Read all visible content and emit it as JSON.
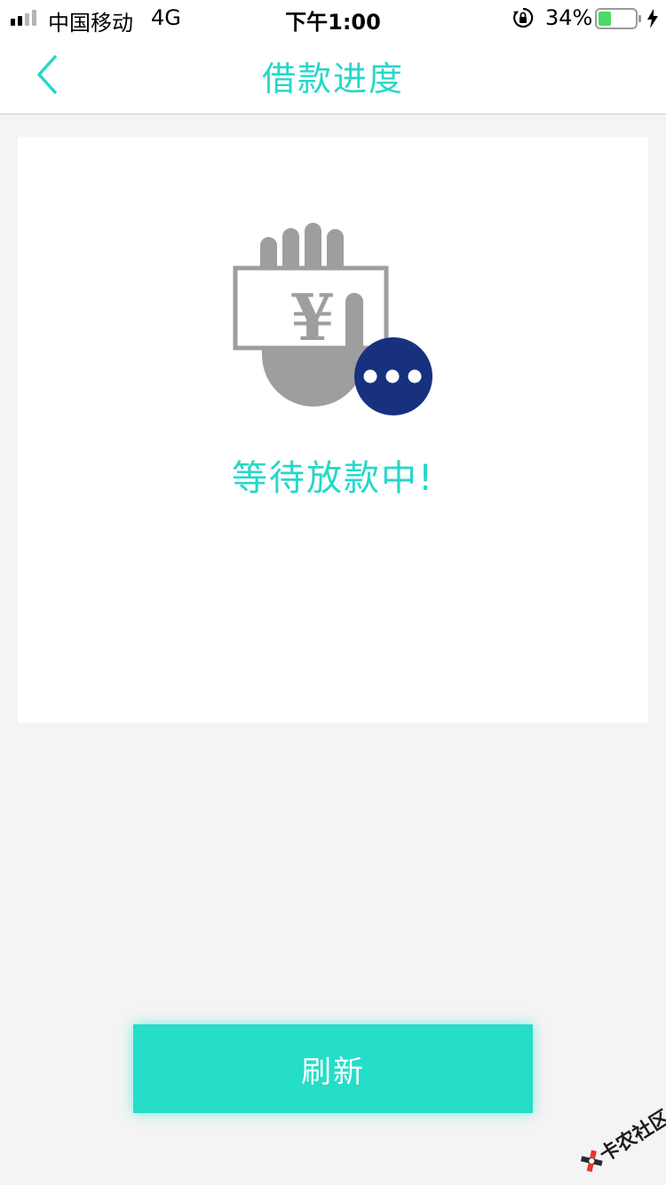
{
  "status_bar": {
    "carrier": "中国移动",
    "network": "4G",
    "time": "下午1:00",
    "battery_percent": "34%",
    "battery_level": 0.34,
    "charging": true,
    "icons": [
      "signal-icon",
      "orientation-lock-icon",
      "battery-icon",
      "charging-bolt-icon"
    ]
  },
  "nav": {
    "title": "借款进度",
    "back_icon": "chevron-left-icon"
  },
  "card": {
    "illustration_icon": "hand-holding-yuan-bill-icon",
    "currency_symbol": "¥",
    "badge_icon": "ellipsis-icon",
    "status_text": "等待放款中!"
  },
  "actions": {
    "refresh_label": "刷新"
  },
  "watermark": {
    "text": "卡农社区"
  },
  "colors": {
    "accent": "#26d8c8",
    "button": "#25ddc9",
    "badge": "#17317f",
    "illustration_gray": "#9e9e9e",
    "background": "#f4f4f4"
  }
}
